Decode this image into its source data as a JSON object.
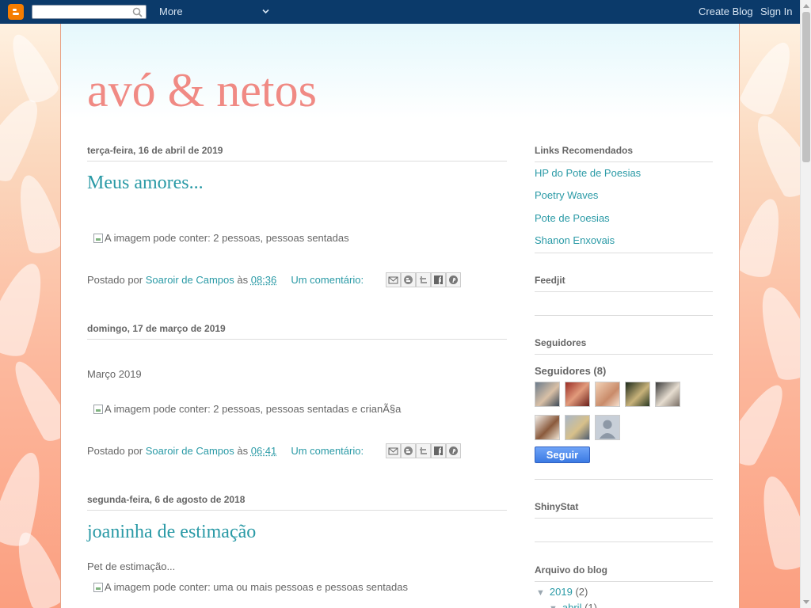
{
  "navbar": {
    "more_label": "More",
    "create_blog_label": "Create Blog",
    "sign_in_label": "Sign In",
    "search_value": ""
  },
  "blog": {
    "title": "avó & netos"
  },
  "posts": [
    {
      "date": "terça-feira, 16 de abril de 2019",
      "title": "Meus amores...",
      "text": "",
      "image_alt": "A imagem pode conter: 2 pessoas, pessoas sentadas",
      "posted_by_label": "Postado por",
      "author": "Soaroir de Campos",
      "at_label": "às",
      "time": "08:36",
      "comments": "Um comentário:"
    },
    {
      "date": "domingo, 17 de março de 2019",
      "title": "",
      "text": "Março 2019",
      "image_alt": "A imagem pode conter: 2 pessoas, pessoas sentadas e crianÃ§a",
      "posted_by_label": "Postado por",
      "author": "Soaroir de Campos",
      "at_label": "às",
      "time": "06:41",
      "comments": "Um comentário:"
    },
    {
      "date": "segunda-feira, 6 de agosto de 2018",
      "title": "joaninha de estimação",
      "text": "Pet de estimação...",
      "image_alt": "A imagem pode conter: uma ou mais pessoas e pessoas sentadas"
    }
  ],
  "share_icons": [
    "email-icon",
    "blogger-icon",
    "twitter-icon",
    "facebook-icon",
    "pinterest-icon"
  ],
  "sidebar": {
    "links_heading": "Links Recomendados",
    "links": [
      "HP do Pote de Poesias",
      "Poetry Waves",
      "Pote de Poesias",
      "Shanon Enxovais"
    ],
    "feedjit_heading": "Feedjit",
    "followers_heading": "Seguidores",
    "followers_count_label": "Seguidores (8)",
    "follow_button": "Seguir",
    "shinystat_heading": "ShinyStat",
    "archive_heading": "Arquivo do blog",
    "archive_year": "2019",
    "archive_year_count": "(2)",
    "archive_month": "abril",
    "archive_month_count": "(1)"
  },
  "colors": {
    "navbar": "#0b3a6a",
    "link": "#2a9aa6",
    "title": "#f08a84",
    "follow_button": "#3b7ae3"
  }
}
